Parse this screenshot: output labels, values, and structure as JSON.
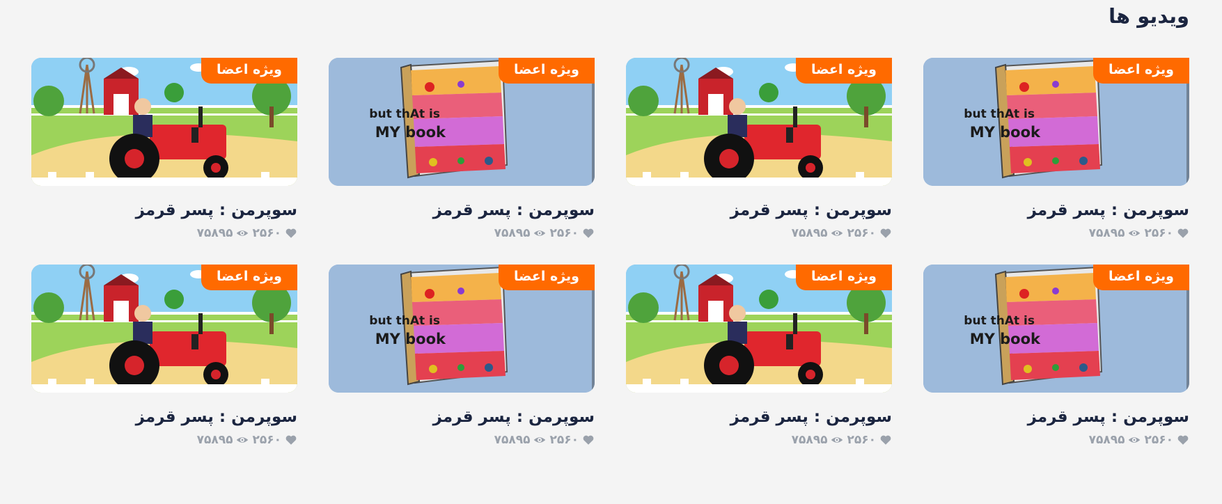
{
  "section": {
    "title": "ویدیو ها"
  },
  "videos": [
    {
      "thumbnail": "book",
      "badge": "ویژه اعضا",
      "title": "سوپرمن : پسر قرمز",
      "likes": "۲۵۶۰",
      "views": "۷۵۸۹۵"
    },
    {
      "thumbnail": "tractor",
      "badge": "ویژه اعضا",
      "title": "سوپرمن : پسر قرمز",
      "likes": "۲۵۶۰",
      "views": "۷۵۸۹۵"
    },
    {
      "thumbnail": "book",
      "badge": "ویژه اعضا",
      "title": "سوپرمن : پسر قرمز",
      "likes": "۲۵۶۰",
      "views": "۷۵۸۹۵"
    },
    {
      "thumbnail": "tractor",
      "badge": "ویژه اعضا",
      "title": "سوپرمن : پسر قرمز",
      "likes": "۲۵۶۰",
      "views": "۷۵۸۹۵"
    },
    {
      "thumbnail": "book",
      "badge": "ویژه اعضا",
      "title": "سوپرمن : پسر قرمز",
      "likes": "۲۵۶۰",
      "views": "۷۵۸۹۵"
    },
    {
      "thumbnail": "tractor",
      "badge": "ویژه اعضا",
      "title": "سوپرمن : پسر قرمز",
      "likes": "۲۵۶۰",
      "views": "۷۵۸۹۵"
    },
    {
      "thumbnail": "book",
      "badge": "ویژه اعضا",
      "title": "سوپرمن : پسر قرمز",
      "likes": "۲۵۶۰",
      "views": "۷۵۸۹۵"
    },
    {
      "thumbnail": "tractor",
      "badge": "ویژه اعضا",
      "title": "سوپرمن : پسر قرمز",
      "likes": "۲۵۶۰",
      "views": "۷۵۸۹۵"
    }
  ],
  "thumb_text": {
    "book_line1": "but thAt is",
    "book_line2": "MY book"
  },
  "colors": {
    "badge": "#ff6a00",
    "title": "#1b2540",
    "meta": "#9aa1ab",
    "background": "#f4f4f4"
  },
  "icons": {
    "likes": "heart-icon",
    "views": "eye-icon"
  }
}
